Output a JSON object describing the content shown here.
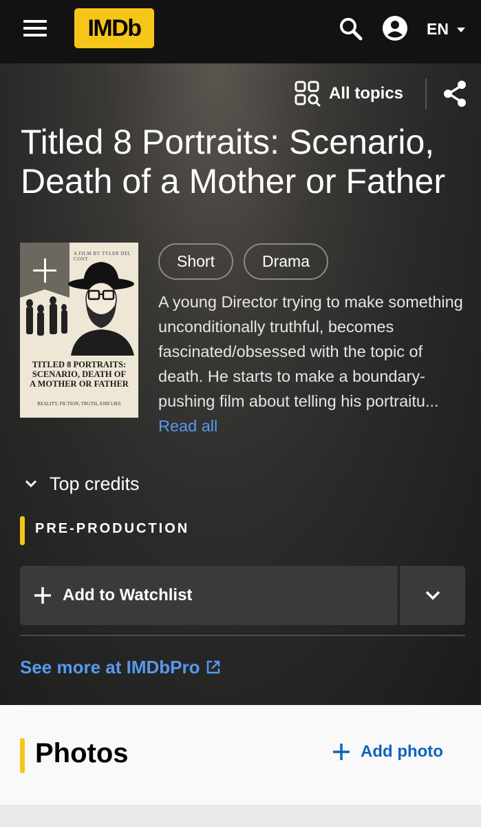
{
  "header": {
    "logo_text": "IMDb",
    "language": "EN",
    "menu_icon": "hamburger-menu-icon",
    "search_icon": "search-icon",
    "account_icon": "account-circle-icon"
  },
  "hero": {
    "all_topics_label": "All topics",
    "title": "Titled 8 Portraits: Scenario, Death of a Mother or Father",
    "genres": [
      "Short",
      "Drama"
    ],
    "plot": "A young Director trying to make something unconditionally truthful, becomes fascinated/obsessed with the topic of death. He starts to make a boundary-pushing film about telling his portraitu...",
    "read_all_label": "Read all",
    "top_credits_label": "Top credits",
    "status": "PRE-PRODUCTION",
    "watchlist_label": "Add to Watchlist",
    "imdbpro_label": "See more at IMDbPro"
  },
  "poster": {
    "credit_line": "A FILM BY TYLER DEL CONT",
    "title_line1": "TITLED 8 PORTRAITS:",
    "title_line2": "SCENARIO, DEATH OF",
    "title_line3": "A MOTHER OR FATHER",
    "subtitle": "REALITY, FICTION, TRUTH, AND LIES"
  },
  "photos": {
    "heading": "Photos",
    "add_label": "Add photo"
  },
  "colors": {
    "brand_yellow": "#f5c518",
    "link_blue": "#5799ef",
    "add_blue": "#0e63be"
  }
}
